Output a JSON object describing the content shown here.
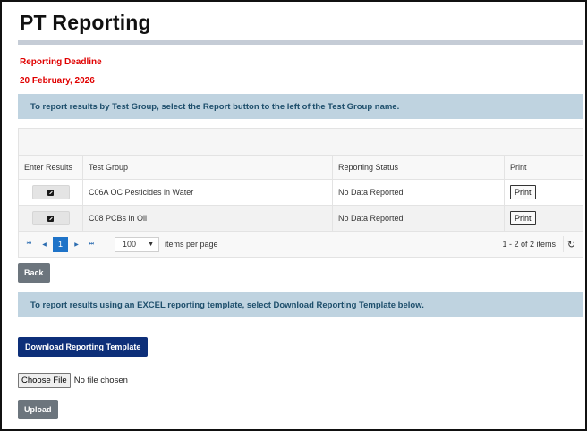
{
  "page": {
    "title": "PT Reporting",
    "deadline_label": "Reporting Deadline",
    "deadline_date": "20 February, 2026",
    "test_group_instruction": "To report results by Test Group, select the Report button to the left of the Test Group name.",
    "excel_instruction": "To report results using an EXCEL reporting template, select Download Reporting Template below."
  },
  "grid": {
    "columns": [
      "Enter Results",
      "Test Group",
      "Reporting Status",
      "Print"
    ],
    "rows": [
      {
        "test_group": "C06A OC Pesticides in Water",
        "status": "No Data Reported",
        "print_label": "Print"
      },
      {
        "test_group": "C08 PCBs in Oil",
        "status": "No Data Reported",
        "print_label": "Print"
      }
    ],
    "pager": {
      "first": "⏮",
      "prev": "◀",
      "current_page": "1",
      "next": "▶",
      "last": "⏭",
      "page_size": "100",
      "items_per_page_label": "items per page",
      "info": "1 - 2 of 2 items",
      "refresh_icon": "↻"
    }
  },
  "buttons": {
    "back": "Back",
    "download_template": "Download Reporting Template",
    "choose_file": "Choose File",
    "no_file": "No file chosen",
    "upload": "Upload"
  },
  "colors": {
    "deadline": "#e00000",
    "banner_bg": "#bfd3e0",
    "primary": "#0d2f79",
    "secondary": "#6c757d",
    "pager_active": "#1e73c8"
  }
}
